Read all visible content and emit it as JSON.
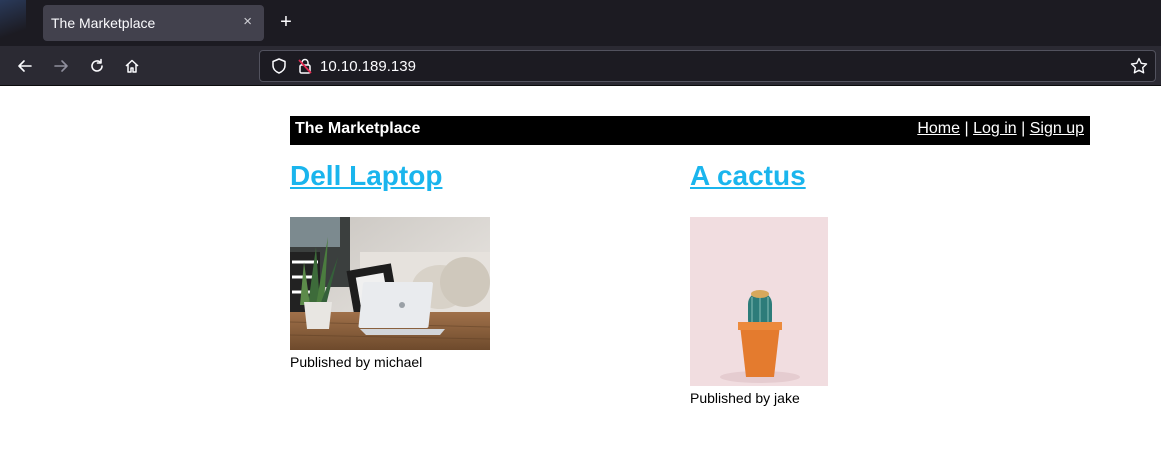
{
  "browser": {
    "tab_title": "The Marketplace",
    "tab_close": "×",
    "new_tab": "+",
    "url": "10.10.189.139"
  },
  "site": {
    "title": "The Marketplace",
    "nav": {
      "home": "Home",
      "separator": "|",
      "login": "Log in",
      "signup": "Sign up"
    }
  },
  "products": [
    {
      "title": "Dell Laptop",
      "published": "Published by michael"
    },
    {
      "title": "A cactus",
      "published": "Published by jake"
    }
  ]
}
